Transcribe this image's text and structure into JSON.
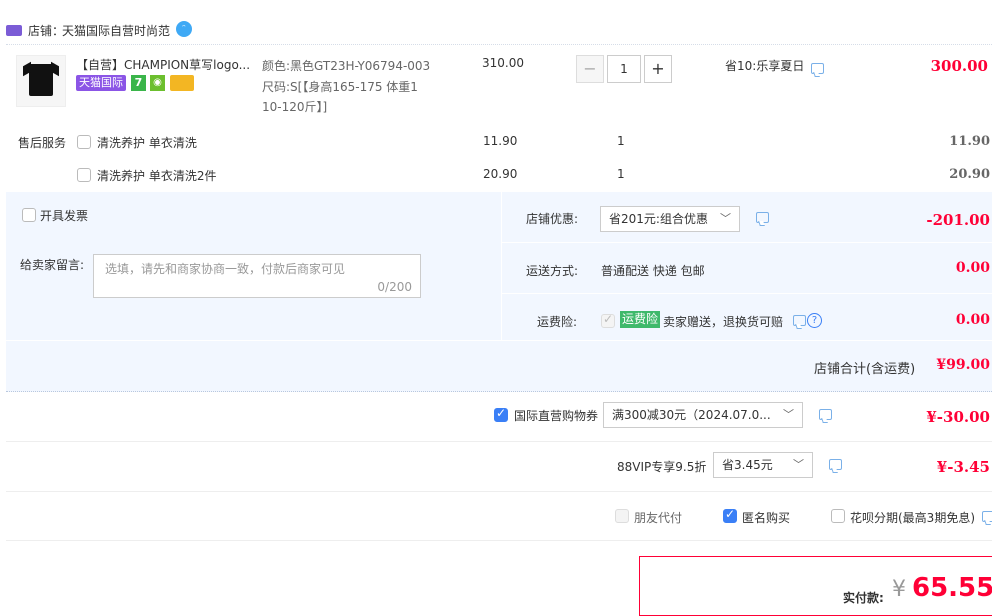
{
  "shop": {
    "prefix": "店铺：",
    "name": "天猫国际自营时尚范"
  },
  "product": {
    "title": "【自营】CHAMPION草写logo...",
    "badge_tmall": "天猫国际",
    "color_label": "颜色:",
    "color_value": "黑色GT23H-Y06794-003",
    "size_label": "尺码:",
    "size_value_line1": "S[【身高165-175 体重1",
    "size_value_line2": "10-120斤】]",
    "unit_price": "310.00",
    "quantity": "1",
    "discount_text": "省10:乐享夏日",
    "subtotal": "300.00"
  },
  "after_sales": {
    "label": "售后服务",
    "items": [
      {
        "name": "清洗养护 单衣清洗",
        "price": "11.90",
        "qty": "1",
        "subtotal": "11.90"
      },
      {
        "name": "清洗养护 单衣清洗2件",
        "price": "20.90",
        "qty": "1",
        "subtotal": "20.90"
      }
    ]
  },
  "invoice": {
    "label": "开具发票"
  },
  "message": {
    "label": "给卖家留言:",
    "placeholder": "选填，请先和商家协商一致，付款后商家可见",
    "counter": "0/200"
  },
  "shop_discount": {
    "label": "店铺优惠:",
    "selected": "省201元:组合优惠",
    "amount": "-201.00"
  },
  "shipping": {
    "label": "运送方式:",
    "value": "普通配送 快递 包邮",
    "amount": "0.00"
  },
  "insurance": {
    "label": "运费险:",
    "badge": "运费险",
    "text": "卖家赠送，退换货可赔",
    "amount": "0.00"
  },
  "shop_total": {
    "label": "店铺合计(含运费)",
    "amount": "¥99.00"
  },
  "coupon": {
    "label": "国际直营购物券",
    "selected": "满300减30元（2024.07.0...",
    "amount": "¥-30.00"
  },
  "vip": {
    "label": "88VIP专享9.5折",
    "selected": "省3.45元",
    "amount": "¥-3.45"
  },
  "options": {
    "friend_pay": "朋友代付",
    "anonymous": "匿名购买",
    "huabei": "花呗分期(最高3期免息)"
  },
  "payment": {
    "label": "实付款:",
    "currency": "¥",
    "amount": "65.55"
  },
  "colors": {
    "accent_red": "#ff0036",
    "blue_bg": "#f2f7ff",
    "checkbox_blue": "#3a7ff6",
    "insurance_green": "#3fb96b"
  }
}
